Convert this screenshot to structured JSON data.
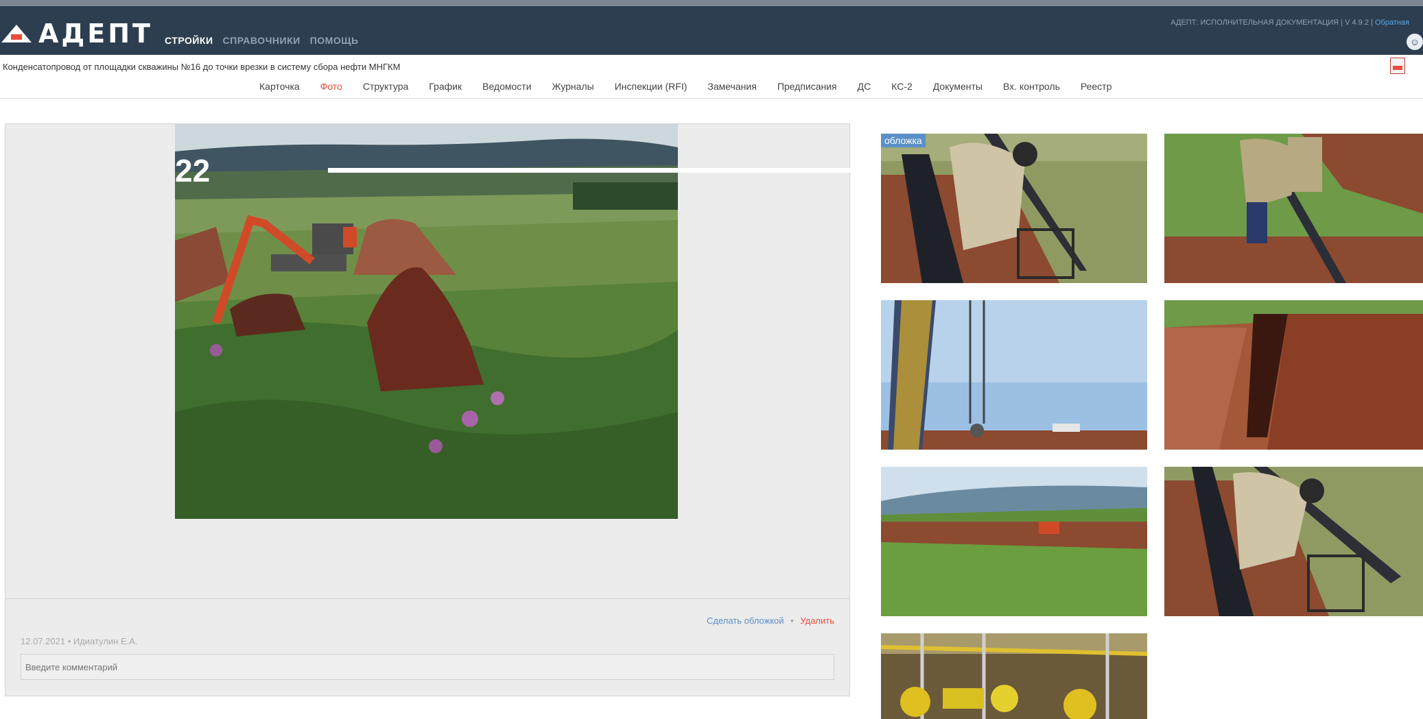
{
  "app": {
    "logo_text": "АДЕПТ",
    "nav": [
      {
        "label": "стройки",
        "active": true
      },
      {
        "label": "справочники",
        "active": false
      },
      {
        "label": "помощь",
        "active": false
      }
    ],
    "product_name": "АДЕПТ: ИСПОЛНИТЕЛЬНАЯ ДОКУМЕНТАЦИЯ",
    "version": "V 4.9.2",
    "feedback_link": "Обратная"
  },
  "project": {
    "title": "Конденсатопровод от площадки скважины №16 до точки врезки в систему сбора нефти МНГКМ"
  },
  "tabs": [
    {
      "label": "Карточка",
      "active": false
    },
    {
      "label": "Фото",
      "active": true
    },
    {
      "label": "Структура",
      "active": false
    },
    {
      "label": "График",
      "active": false
    },
    {
      "label": "Ведомости",
      "active": false
    },
    {
      "label": "Журналы",
      "active": false
    },
    {
      "label": "Инспекции (RFI)",
      "active": false
    },
    {
      "label": "Замечания",
      "active": false
    },
    {
      "label": "Предписания",
      "active": false
    },
    {
      "label": "ДС",
      "active": false
    },
    {
      "label": "КС-2",
      "active": false
    },
    {
      "label": "Документы",
      "active": false
    },
    {
      "label": "Вх. контроль",
      "active": false
    },
    {
      "label": "Реестр",
      "active": false
    }
  ],
  "photo": {
    "make_cover": "Сделать обложкой",
    "separator": "•",
    "delete": "Удалить",
    "date": "12.07.2021",
    "author": "Идиатулин Е.А.",
    "comment_placeholder": "Введите комментарий"
  },
  "overlay": {
    "number": "22"
  },
  "thumbnails": {
    "cover_label": "обложка",
    "items": [
      {
        "subject": "worker-pipe"
      },
      {
        "subject": "workers-trench"
      },
      {
        "subject": "crane-sky"
      },
      {
        "subject": "trench-deep"
      },
      {
        "subject": "field-excavator"
      },
      {
        "subject": "worker-pipe-2"
      },
      {
        "subject": "yellow-valves"
      }
    ]
  },
  "colors": {
    "navbar": "#2c3e50",
    "active_tab": "#e74c3c",
    "link": "#5b8fc7",
    "delete": "#e74c3c"
  }
}
